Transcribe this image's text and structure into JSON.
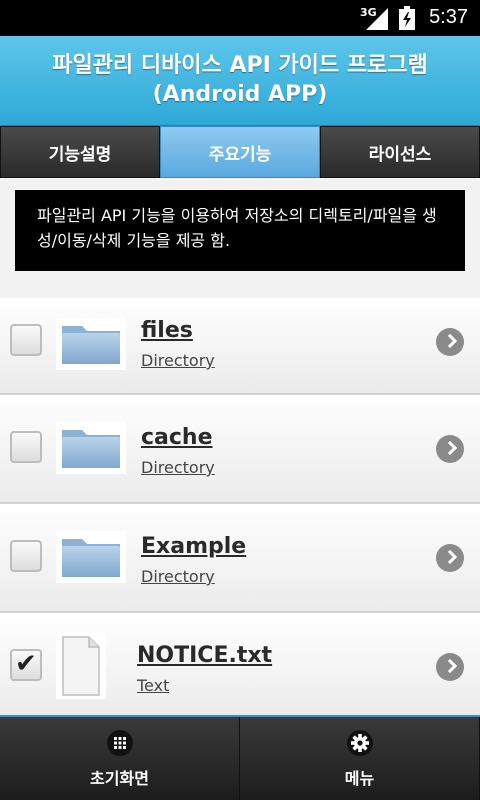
{
  "status": {
    "network": "3G",
    "time": "5:37"
  },
  "header": {
    "title_line1": "파일관리 디바이스 API 가이드 프로그램",
    "title_line2": "(Android APP)"
  },
  "tabs": [
    {
      "label": "기능설명",
      "active": false
    },
    {
      "label": "주요기능",
      "active": true
    },
    {
      "label": "라이선스",
      "active": false
    }
  ],
  "description": "파일관리 API 기능을 이용하여 저장소의 디렉토리/파일을 생성/이동/삭제 기능을 제공 함.",
  "items": [
    {
      "name": "files",
      "type": "Directory",
      "icon": "folder-icon",
      "checked": false
    },
    {
      "name": "cache",
      "type": "Directory",
      "icon": "folder-icon",
      "checked": false
    },
    {
      "name": "Example",
      "type": "Directory",
      "icon": "folder-icon",
      "checked": false
    },
    {
      "name": "NOTICE.txt",
      "type": "Text",
      "icon": "file-icon",
      "checked": true
    }
  ],
  "bottom": {
    "home_label": "초기화면",
    "menu_label": "메뉴"
  },
  "colors": {
    "header_accent": "#2ea8d8",
    "active_tab": "#5aa8df"
  }
}
